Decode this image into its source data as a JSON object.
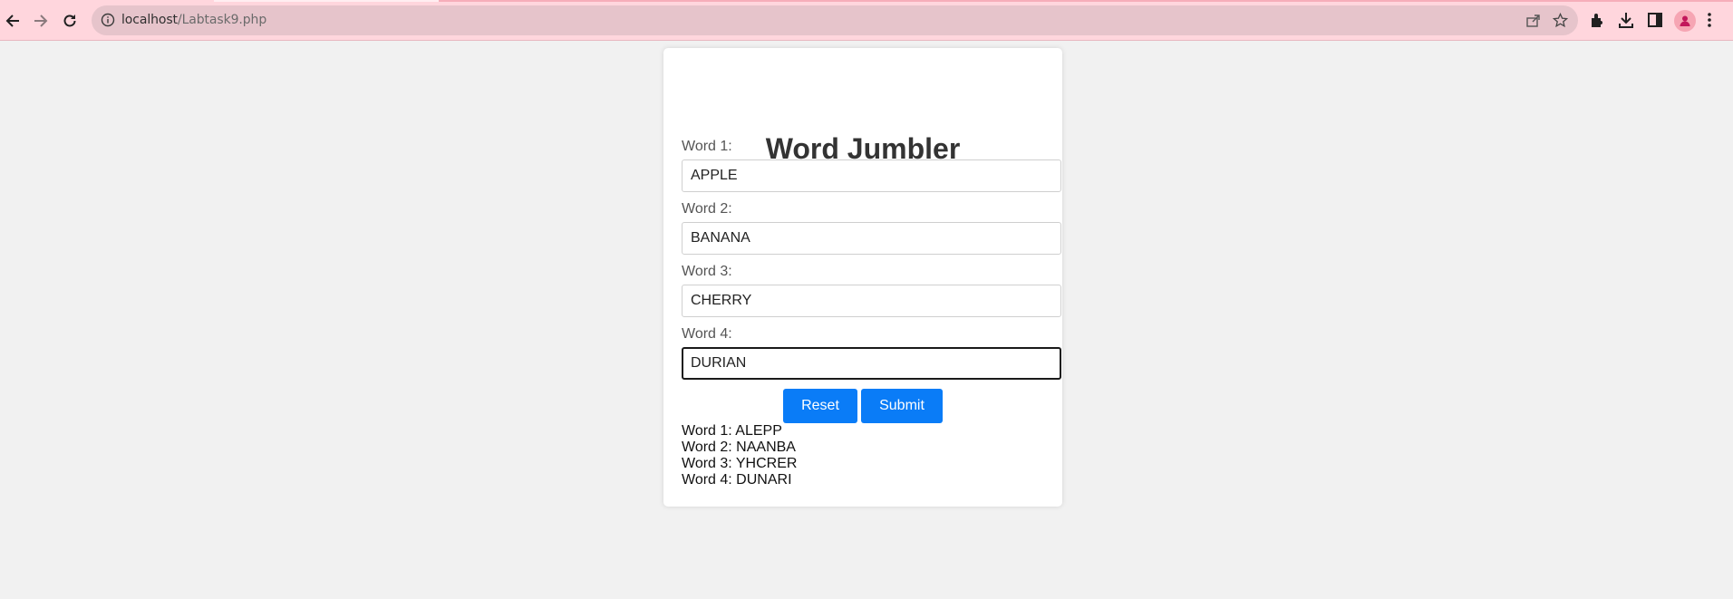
{
  "browser": {
    "url_host": "localhost",
    "url_path": "/Labtask9.php",
    "icons": [
      "back-icon",
      "forward-icon",
      "reload-icon",
      "info-icon",
      "share-icon",
      "star-icon",
      "extensions-icon",
      "download-icon",
      "side-panel-icon",
      "profile-icon",
      "menu-icon"
    ]
  },
  "app": {
    "title": "Word Jumbler",
    "fields": [
      {
        "label": "Word 1:",
        "value": "APPLE"
      },
      {
        "label": "Word 2:",
        "value": "BANANA"
      },
      {
        "label": "Word 3:",
        "value": "CHERRY"
      },
      {
        "label": "Word 4:",
        "value": "DURIAN"
      }
    ],
    "reset_label": "Reset",
    "submit_label": "Submit",
    "results": [
      "Word 1: ALEPP",
      "Word 2: NAANBA",
      "Word 3: YHCRER",
      "Word 4: DUNARI"
    ]
  },
  "colors": {
    "chrome_bg": "#ffd6dd",
    "omnibox_bg": "#e6c4cb",
    "page_bg": "#f1f1f1",
    "button_bg": "#0a7cf7",
    "avatar_accent": "#c2185b"
  }
}
